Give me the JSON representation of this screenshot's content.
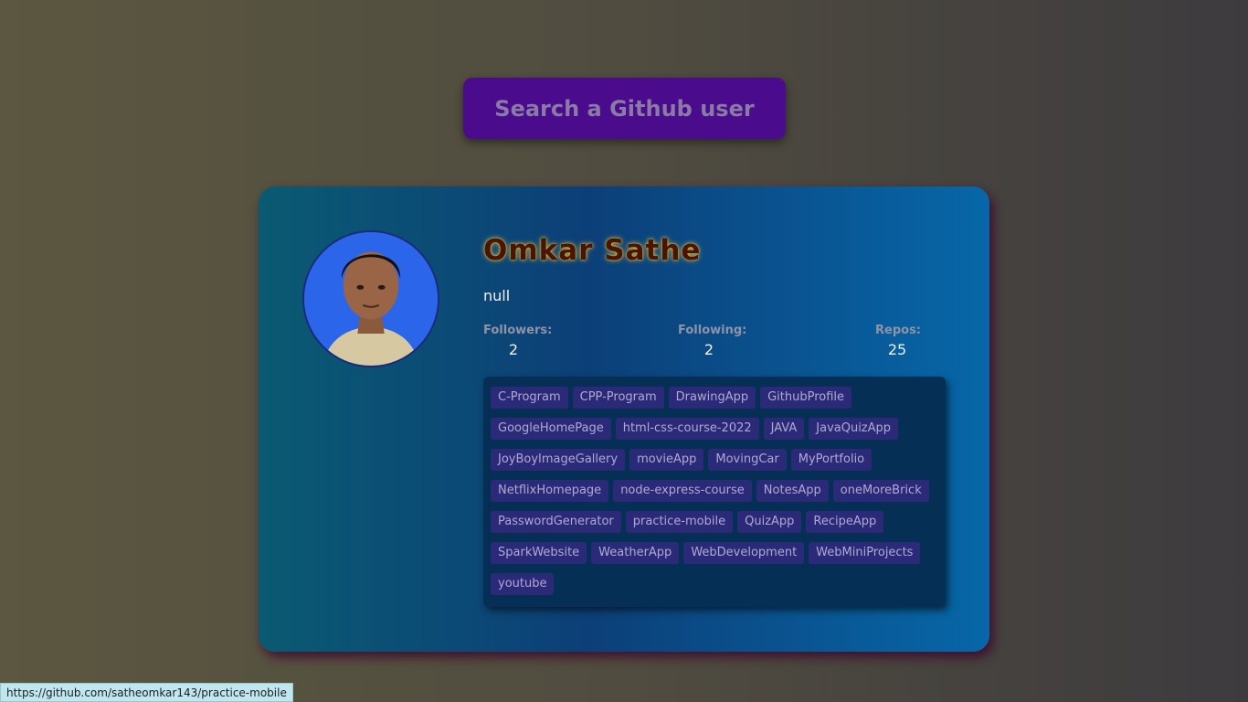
{
  "search": {
    "placeholder": "Search a Github user"
  },
  "profile": {
    "name": "Omkar Sathe",
    "bio": "null",
    "followers_label": "Followers:",
    "followers": "2",
    "following_label": "Following:",
    "following": "2",
    "repos_label": "Repos:",
    "repos": "25"
  },
  "repos": [
    "C-Program",
    "CPP-Program",
    "DrawingApp",
    "GithubProfile",
    "GoogleHomePage",
    "html-css-course-2022",
    "JAVA",
    "JavaQuizApp",
    "JoyBoyImageGallery",
    "movieApp",
    "MovingCar",
    "MyPortfolio",
    "NetflixHomepage",
    "node-express-course",
    "NotesApp",
    "oneMoreBrick",
    "PasswordGenerator",
    "practice-mobile",
    "QuizApp",
    "RecipeApp",
    "SparkWebsite",
    "WeatherApp",
    "WebDevelopment",
    "WebMiniProjects",
    "youtube"
  ],
  "status_bar": {
    "url": "https://github.com/satheomkar143/practice-mobile"
  },
  "colors": {
    "card_accent": "#0c3f78",
    "search_bg": "#4a0b8c",
    "repo_tag_bg": "#2b2a78"
  }
}
